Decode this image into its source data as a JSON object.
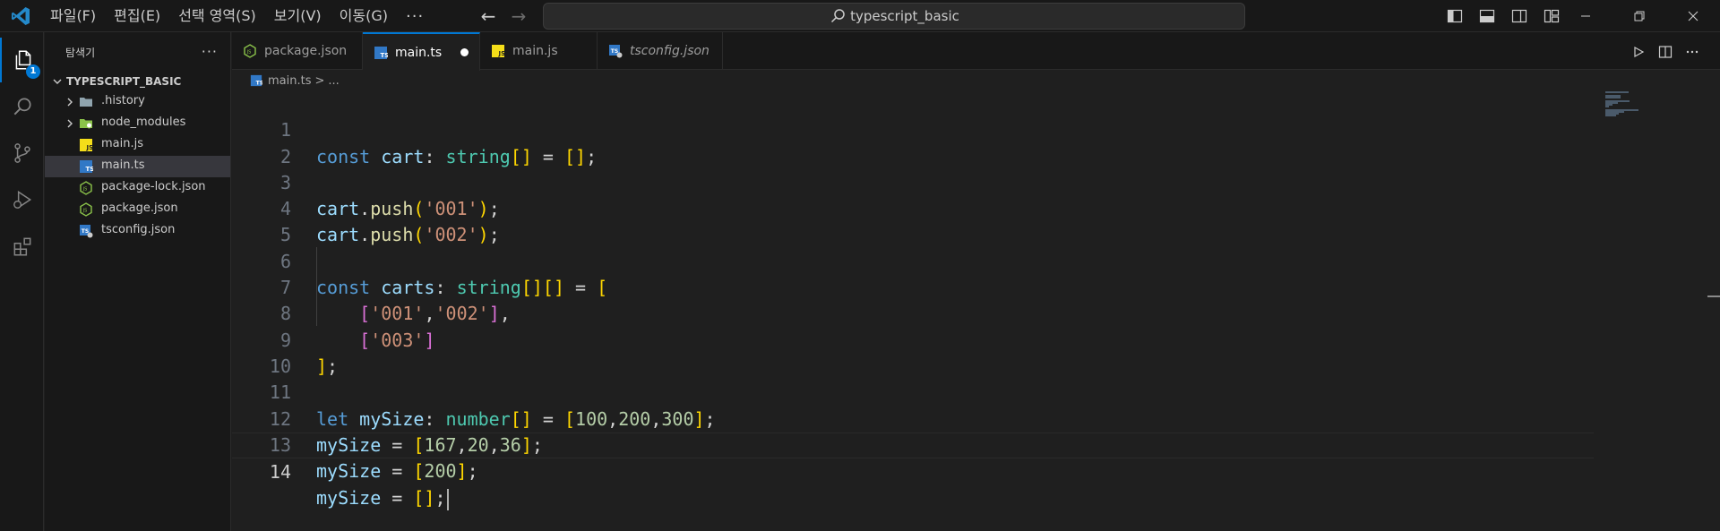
{
  "titlebar": {
    "menu": [
      "파일(F)",
      "편집(E)",
      "선택 영역(S)",
      "보기(V)",
      "이동(G)"
    ],
    "more": "···",
    "search": "typescript_basic"
  },
  "activity": {
    "explorer_badge": "1"
  },
  "sidebar": {
    "title": "탐색기",
    "more": "···",
    "folder": "TYPESCRIPT_BASIC",
    "items": [
      {
        "label": ".history"
      },
      {
        "label": "node_modules"
      },
      {
        "label": "main.js"
      },
      {
        "label": "main.ts"
      },
      {
        "label": "package-lock.json"
      },
      {
        "label": "package.json"
      },
      {
        "label": "tsconfig.json"
      }
    ]
  },
  "tabs": [
    {
      "label": "package.json"
    },
    {
      "label": "main.ts"
    },
    {
      "label": "main.js"
    },
    {
      "label": "tsconfig.json"
    }
  ],
  "breadcrumb": {
    "file": "main.ts",
    "sep": ">",
    "rest": "..."
  },
  "code": {
    "line_numbers": [
      "1",
      "2",
      "3",
      "4",
      "5",
      "6",
      "7",
      "8",
      "9",
      "10",
      "11",
      "12",
      "13",
      "14"
    ],
    "lines": [
      "const cart: string[] = [];",
      "",
      "cart.push('001');",
      "cart.push('002');",
      "",
      "const carts: string[][] = [",
      "    ['001','002'],",
      "    ['003']",
      "];",
      "",
      "let mySize: number[] = [100,200,300];",
      "mySize = [167,20,36];",
      "mySize = [200];",
      "mySize = [];"
    ]
  },
  "colors": {
    "accent": "#0078d4",
    "keyword": "#569cd6",
    "variable": "#9cdcfe",
    "type": "#4ec9b0",
    "function": "#dcdcaa",
    "string": "#ce9178",
    "number": "#b5cea8",
    "bracket_1": "#ffd700",
    "bracket_2": "#da70d6"
  },
  "icons": {
    "app": "vscode-logo-icon",
    "explorer": "files-icon",
    "search": "search-icon",
    "scm": "source-control-icon",
    "debug": "run-debug-icon",
    "extensions": "extensions-icon",
    "run": "play-icon",
    "split": "split-editor-icon"
  }
}
